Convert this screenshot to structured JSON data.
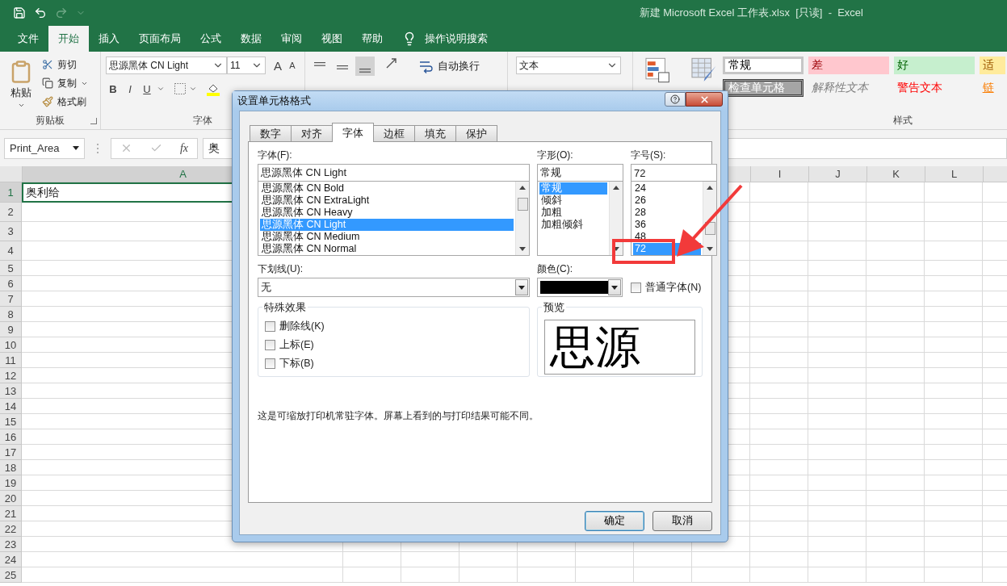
{
  "window": {
    "title": "新建 Microsoft Excel 工作表.xlsx  [只读]  -  Excel"
  },
  "ribbon_tabs": [
    {
      "label": "文件",
      "selected": false
    },
    {
      "label": "开始",
      "selected": true
    },
    {
      "label": "插入",
      "selected": false
    },
    {
      "label": "页面布局",
      "selected": false
    },
    {
      "label": "公式",
      "selected": false
    },
    {
      "label": "数据",
      "selected": false
    },
    {
      "label": "审阅",
      "selected": false
    },
    {
      "label": "视图",
      "selected": false
    },
    {
      "label": "帮助",
      "selected": false
    }
  ],
  "tell_me": "操作说明搜索",
  "clipboard": {
    "paste": "粘贴",
    "cut": "剪切",
    "copy": "复制",
    "format_painter": "格式刷",
    "label": "剪贴板"
  },
  "font_group": {
    "font": "思源黑体 CN Light",
    "size": "11",
    "grow": "A",
    "shrink": "A",
    "bold": "B",
    "italic": "I",
    "underline": "U",
    "label": "字体"
  },
  "alignment": {
    "buttons": [
      {
        "kind": "top",
        "selected": false
      },
      {
        "kind": "middle",
        "selected": false
      },
      {
        "kind": "bottom",
        "selected": true
      }
    ],
    "wrap_text": "自动换行"
  },
  "number": {
    "format": "文本"
  },
  "styles": {
    "items": [
      {
        "label": "常规",
        "kind": "normal"
      },
      {
        "label": "差",
        "kind": "bad"
      },
      {
        "label": "好",
        "kind": "good"
      },
      {
        "label": "适",
        "kind": "neutral"
      },
      {
        "label": "检查单元格",
        "kind": "check"
      },
      {
        "label": "解释性文本",
        "kind": "explanatory"
      },
      {
        "label": "警告文本",
        "kind": "warning"
      },
      {
        "label": "链",
        "kind": "linked"
      }
    ],
    "label": "样式"
  },
  "formula_bar": {
    "name_box": "Print_Area",
    "fx": "fx",
    "value": "奥"
  },
  "sheet": {
    "columns_left": [
      "A"
    ],
    "columns_right": [
      "I",
      "J",
      "K",
      "L"
    ],
    "rows": [
      {
        "number": "1",
        "cell_a": "奥利给",
        "selected": true
      },
      {
        "number": "2",
        "selected": false
      },
      {
        "number": "3",
        "selected": false
      },
      {
        "number": "4",
        "selected": false
      },
      {
        "number": "5",
        "selected": false
      },
      {
        "number": "6",
        "selected": false
      },
      {
        "number": "7",
        "selected": false
      },
      {
        "number": "8",
        "selected": false
      },
      {
        "number": "9",
        "selected": false
      },
      {
        "number": "10",
        "selected": false
      },
      {
        "number": "11",
        "selected": false
      },
      {
        "number": "12",
        "selected": false
      },
      {
        "number": "13",
        "selected": false
      },
      {
        "number": "14",
        "selected": false
      },
      {
        "number": "15",
        "selected": false
      },
      {
        "number": "16",
        "selected": false
      },
      {
        "number": "17",
        "selected": false
      },
      {
        "number": "18",
        "selected": false
      },
      {
        "number": "19",
        "selected": false
      },
      {
        "number": "20",
        "selected": false
      },
      {
        "number": "21",
        "selected": false
      },
      {
        "number": "22",
        "selected": false
      },
      {
        "number": "23",
        "selected": false
      },
      {
        "number": "24",
        "selected": false
      },
      {
        "number": "25",
        "selected": false
      }
    ]
  },
  "dialog": {
    "title": "设置单元格格式",
    "tabs": [
      {
        "label": "数字",
        "selected": false
      },
      {
        "label": "对齐",
        "selected": false
      },
      {
        "label": "字体",
        "selected": true
      },
      {
        "label": "边框",
        "selected": false
      },
      {
        "label": "填充",
        "selected": false
      },
      {
        "label": "保护",
        "selected": false
      }
    ],
    "font": {
      "label": "字体(F):",
      "value": "思源黑体 CN Light",
      "items": [
        {
          "label": "思源黑体 CN Bold",
          "selected": false
        },
        {
          "label": "思源黑体 CN ExtraLight",
          "selected": false
        },
        {
          "label": "思源黑体 CN Heavy",
          "selected": false
        },
        {
          "label": "思源黑体 CN Light",
          "selected": true
        },
        {
          "label": "思源黑体 CN Medium",
          "selected": false
        },
        {
          "label": "思源黑体 CN Normal",
          "selected": false
        }
      ]
    },
    "style": {
      "label": "字形(O):",
      "value": "常规",
      "items": [
        {
          "label": "常规",
          "selected": true
        },
        {
          "label": "倾斜",
          "selected": false
        },
        {
          "label": "加粗",
          "selected": false
        },
        {
          "label": "加粗倾斜",
          "selected": false
        }
      ]
    },
    "size": {
      "label": "字号(S):",
      "value": "72",
      "items": [
        {
          "label": "24",
          "selected": false
        },
        {
          "label": "26",
          "selected": false
        },
        {
          "label": "28",
          "selected": false
        },
        {
          "label": "36",
          "selected": false
        },
        {
          "label": "48",
          "selected": false
        },
        {
          "label": "72",
          "selected": true
        }
      ]
    },
    "underline": {
      "label": "下划线(U):",
      "value": "无"
    },
    "color": {
      "label": "颜色(C):"
    },
    "normal_font": {
      "label": "普通字体(N)",
      "checked": false
    },
    "effects": {
      "label": "特殊效果",
      "items": [
        {
          "label": "删除线(K)",
          "checked": false
        },
        {
          "label": "上标(E)",
          "checked": false
        },
        {
          "label": "下标(B)",
          "checked": false
        }
      ]
    },
    "preview": {
      "label": "预览",
      "sample": "思源"
    },
    "note": "这是可缩放打印机常驻字体。屏幕上看到的与打印结果可能不同。",
    "buttons": [
      {
        "label": "确定",
        "kind": "default"
      },
      {
        "label": "取消",
        "kind": "normal"
      }
    ]
  }
}
